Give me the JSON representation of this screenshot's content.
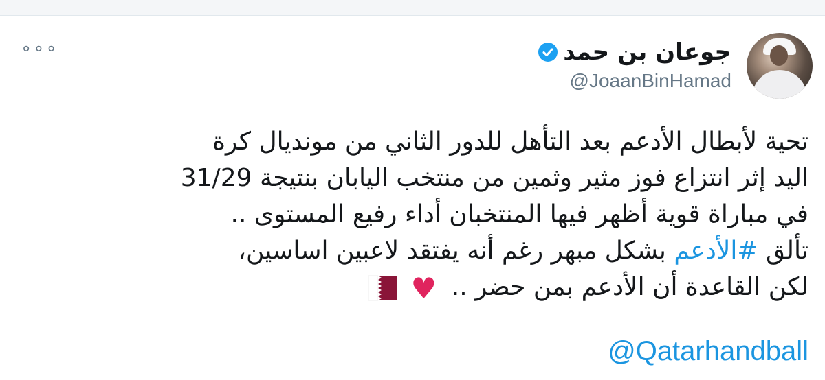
{
  "tweet": {
    "author": {
      "display_name": "جوعان بن حمد",
      "handle": "@JoaanBinHamad",
      "verified": true
    },
    "more_icon_label": "∘∘∘",
    "lines": [
      "تحية لأبطال الأدعم بعد التأهل للدور الثاني من مونديال كرة",
      "اليد إثر انتزاع فوز مثير وثمين من منتخب اليابان بنتيجة 31/29",
      "في مباراة قوية أظهر فيها المنتخبان أداء رفيع المستوى ..",
      "بشكل مبهر رغم أنه يفتقد لاعبين اساسين،",
      "لكن القاعدة أن الأدعم بمن حضر .."
    ],
    "line4_prefix": "تألق",
    "hashtag": "#الأدعم",
    "heart_emoji": "♥",
    "mention": "@Qatarhandball"
  },
  "colors": {
    "link": "#1b95e0",
    "verified": "#1da1f2",
    "heart": "#e0245e",
    "flag_maroon": "#8a1538"
  }
}
